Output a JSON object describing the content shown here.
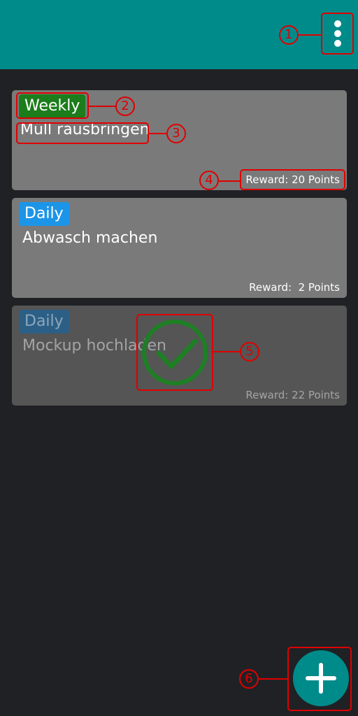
{
  "menu": {
    "icon": "more-vert-icon"
  },
  "tasks": [
    {
      "frequency": "Weekly",
      "title": "Müll rausbringen",
      "reward": "Reward: 20 Points",
      "completed": false
    },
    {
      "frequency": "Daily",
      "title": "Abwasch machen",
      "reward": "Reward:  2 Points",
      "completed": false
    },
    {
      "frequency": "Daily",
      "title": "Mockup hochladen",
      "reward": "Reward: 22 Points",
      "completed": true
    }
  ],
  "fab": {
    "icon": "plus-icon"
  },
  "annotations": [
    "1",
    "2",
    "3",
    "4",
    "5",
    "6"
  ],
  "colors": {
    "primary": "#008B8B",
    "background": "#202124",
    "card": "#7a7a7a",
    "weekly_badge": "#1b7d1b",
    "daily_badge": "#1c95e8",
    "check": "#1e7f24",
    "annotation": "#e00000"
  }
}
